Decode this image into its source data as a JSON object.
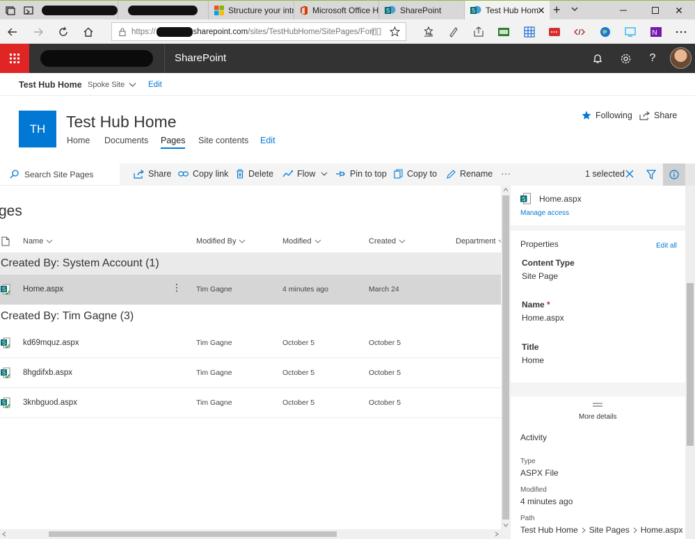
{
  "browser": {
    "tabs": [
      {
        "title": "Structure your intr",
        "icon": "microsoft-logo-icon"
      },
      {
        "title": "Microsoft Office H",
        "icon": "office-logo-icon"
      },
      {
        "title": "SharePoint",
        "icon": "sharepoint-logo-icon"
      },
      {
        "title": "Test Hub Hom",
        "icon": "sharepoint-logo-icon",
        "active": true
      }
    ],
    "new_tab": "+",
    "address": {
      "prefix": "https://",
      "host": "sharepoint.com",
      "path": "/sites/TestHubHome/SitePages/Forr"
    }
  },
  "suitebar": {
    "app_name": "SharePoint",
    "accent": "#e02525"
  },
  "hubnav": {
    "title": "Test Hub Home",
    "spoke": "Spoke Site",
    "edit": "Edit"
  },
  "site": {
    "logo_initials": "TH",
    "logo_color": "#0078d4",
    "title": "Test Hub Home",
    "nav": [
      "Home",
      "Documents",
      "Pages",
      "Site contents"
    ],
    "nav_selected": "Pages",
    "nav_edit": "Edit",
    "following": "Following",
    "share": "Share"
  },
  "commandbar": {
    "search_placeholder": "Search Site Pages",
    "share": "Share",
    "copy_link": "Copy link",
    "delete": "Delete",
    "flow": "Flow",
    "pin_to_top": "Pin to top",
    "copy_to": "Copy to",
    "rename": "Rename",
    "more": "···",
    "selected": "1 selected"
  },
  "list": {
    "heading": "ges",
    "columns": {
      "name": "Name",
      "modified_by": "Modified By",
      "modified": "Modified",
      "created": "Created",
      "department": "Department"
    },
    "groups": [
      {
        "header": "Created By: System Account (1)",
        "rows": [
          {
            "name": "Home.aspx",
            "modified_by": "Tim Gagne",
            "modified": "4 minutes ago",
            "created": "March 24",
            "selected": true
          }
        ]
      },
      {
        "header": "Created By: Tim Gagne (3)",
        "rows": [
          {
            "name": "kd69mquz.aspx",
            "modified_by": "Tim Gagne",
            "modified": "October 5",
            "created": "October 5"
          },
          {
            "name": "8hgdifxb.aspx",
            "modified_by": "Tim Gagne",
            "modified": "October 5",
            "created": "October 5"
          },
          {
            "name": "3knbguod.aspx",
            "modified_by": "Tim Gagne",
            "modified": "October 5",
            "created": "October 5"
          }
        ]
      }
    ]
  },
  "details": {
    "file_name": "Home.aspx",
    "manage_access": "Manage access",
    "properties": "Properties",
    "edit_all": "Edit all",
    "content_type_label": "Content Type",
    "content_type_value": "Site Page",
    "name_label": "Name",
    "name_required": "*",
    "name_value": "Home.aspx",
    "title_label": "Title",
    "title_value": "Home",
    "more_details": "More details",
    "activity": "Activity",
    "type_label": "Type",
    "type_value": "ASPX File",
    "modified_label": "Modified",
    "modified_value": "4 minutes ago",
    "path_label": "Path",
    "path": [
      "Test Hub Home",
      "Site Pages",
      "Home.aspx"
    ]
  }
}
